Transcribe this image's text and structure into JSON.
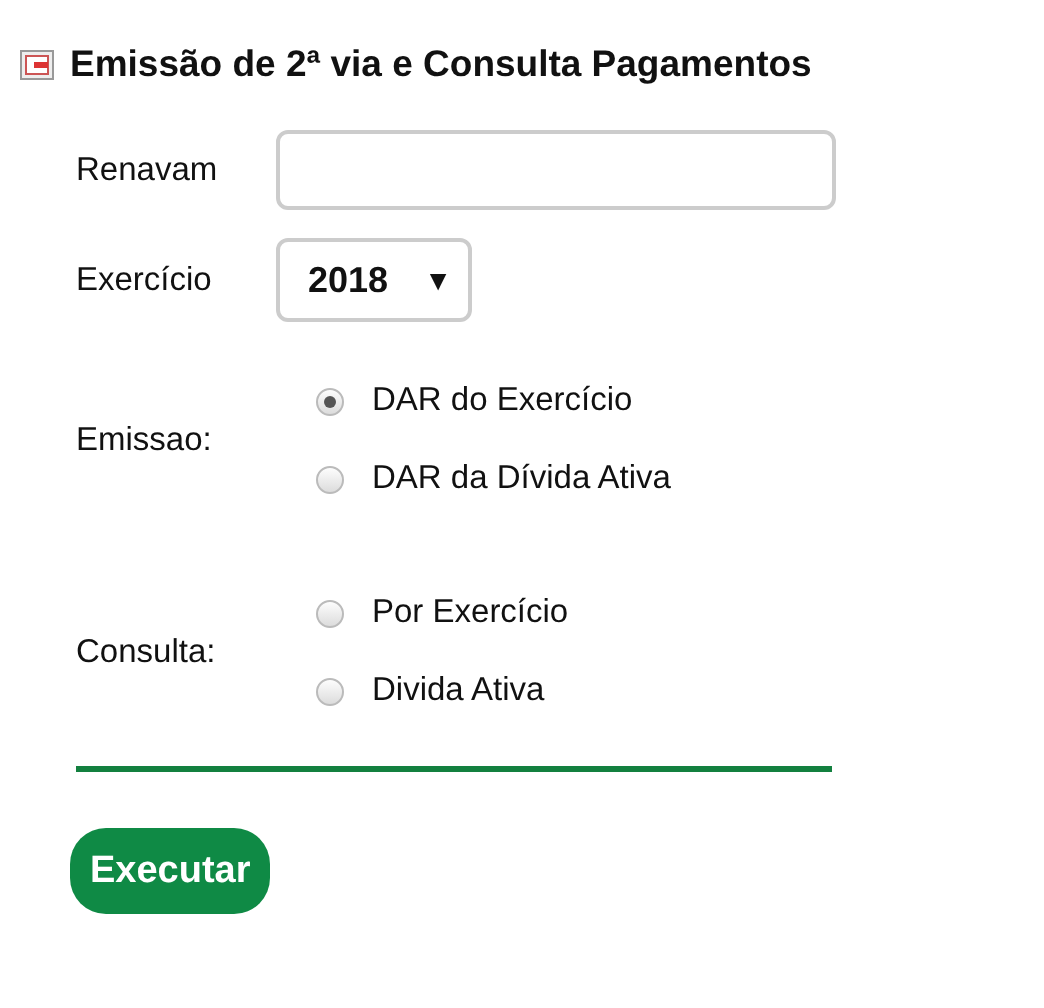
{
  "title": "Emissão de 2ª via e Consulta Pagamentos",
  "renavam": {
    "label": "Renavam"
  },
  "exercicio": {
    "label": "Exercício",
    "value": "2018",
    "arrow": "▼"
  },
  "groups": [
    {
      "label": "Emissao:",
      "options": [
        {
          "label": "DAR do Exercício",
          "selected": true
        },
        {
          "label": "DAR da Dívida Ativa",
          "selected": false
        }
      ]
    },
    {
      "label": "Consulta:",
      "options": [
        {
          "label": "Por Exercício",
          "selected": false
        },
        {
          "label": "Divida Ativa",
          "selected": false
        }
      ]
    }
  ],
  "button": "Executar"
}
